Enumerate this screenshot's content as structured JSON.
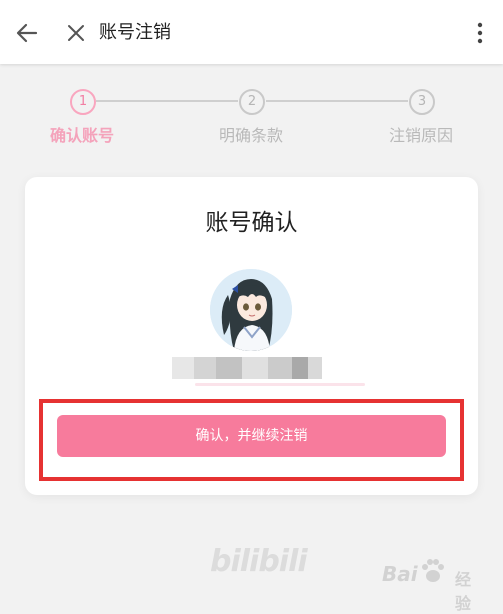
{
  "topbar": {
    "title": "账号注销",
    "back_icon": "arrow-left-icon",
    "close_icon": "close-icon",
    "more_icon": "more-vertical-icon"
  },
  "stepper": {
    "steps": [
      {
        "number": "1",
        "label": "确认账号",
        "state": "active"
      },
      {
        "number": "2",
        "label": "明确条款",
        "state": "inactive"
      },
      {
        "number": "3",
        "label": "注销原因",
        "state": "inactive"
      }
    ]
  },
  "card": {
    "title": "账号确认",
    "confirm_label": "确认，并继续注销"
  },
  "footer": {
    "logo_text": "bilibili",
    "watermark_text": "Bai",
    "watermark_sub": "经验"
  },
  "colors": {
    "accent": "#f77b9c",
    "highlight": "#e63232",
    "step_active": "#f4a3bb"
  }
}
